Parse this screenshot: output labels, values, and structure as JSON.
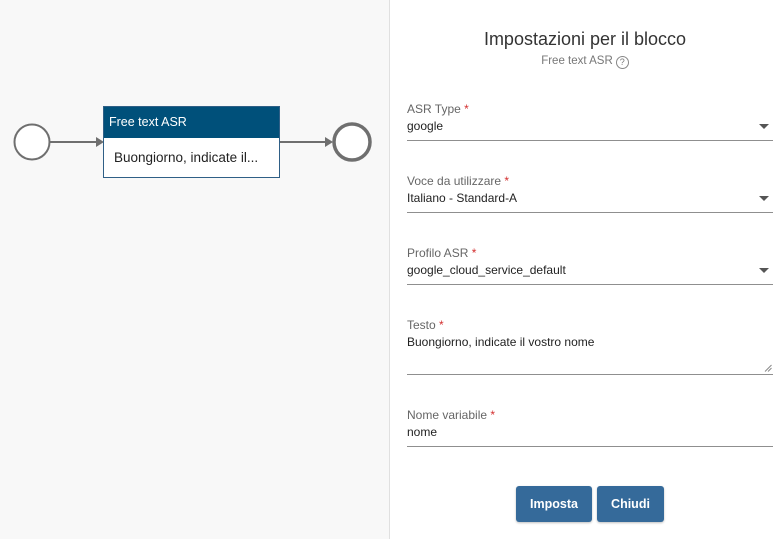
{
  "canvas": {
    "node": {
      "title": "Free text ASR",
      "text": "Buongiorno, indicate il..."
    }
  },
  "panel": {
    "title": "Impostazioni per il blocco",
    "subtitle": "Free text ASR",
    "help_icon": "?",
    "fields": {
      "asr_type": {
        "label": "ASR Type",
        "required": "*",
        "value": "google"
      },
      "voice": {
        "label": "Voce da utilizzare",
        "required": "*",
        "value": "Italiano - Standard-A"
      },
      "asr_profile": {
        "label": "Profilo ASR",
        "required": "*",
        "value": "google_cloud_service_default"
      },
      "text": {
        "label": "Testo",
        "required": "*",
        "value": "Buongiorno, indicate il vostro nome"
      },
      "variable_name": {
        "label": "Nome variabile",
        "required": "*",
        "value": "nome"
      }
    },
    "buttons": {
      "set": "Imposta",
      "close": "Chiudi"
    }
  },
  "colors": {
    "node_header": "#00507a",
    "button": "#356a9a",
    "required": "#d32f2f"
  }
}
